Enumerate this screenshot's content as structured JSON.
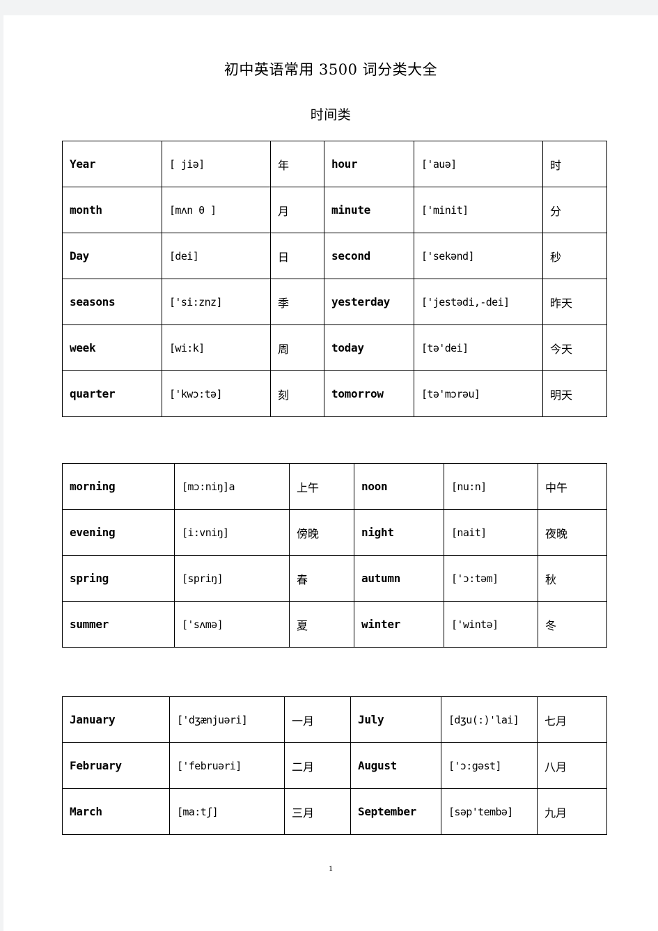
{
  "document": {
    "title": "初中英语常用 3500 词分类大全",
    "subtitle": "时间类",
    "page_number": "1"
  },
  "tables": [
    {
      "name": "time-units",
      "rows": [
        {
          "word_l": "Year",
          "phon_l": "[ jiə]",
          "cn_l": "年",
          "word_r": "hour",
          "phon_r": "['auə]",
          "cn_r": "时"
        },
        {
          "word_l": "month",
          "phon_l": "[mʌn θ ]",
          "cn_l": "月",
          "word_r": "minute",
          "phon_r": "['minit]",
          "cn_r": "分"
        },
        {
          "word_l": "Day",
          "phon_l": "[dei]",
          "cn_l": "日",
          "word_r": "second",
          "phon_r": "['sekənd]",
          "cn_r": "秒"
        },
        {
          "word_l": "seasons",
          "phon_l": "['si:znz]",
          "cn_l": "季",
          "word_r": "yesterday",
          "phon_r": "['jestədi,-dei]",
          "cn_r": "昨天"
        },
        {
          "word_l": "week",
          "phon_l": "[wi:k]",
          "cn_l": "周",
          "word_r": "today",
          "phon_r": "[tə'dei]",
          "cn_r": "今天"
        },
        {
          "word_l": "quarter",
          "phon_l": "['kwɔ:tə]",
          "cn_l": "刻",
          "word_r": "tomorrow",
          "phon_r": "[tə'mɔrəu]",
          "cn_r": "明天"
        }
      ]
    },
    {
      "name": "dayparts-seasons",
      "rows": [
        {
          "word_l": "morning",
          "phon_l": "[mɔ:niŋ]a",
          "cn_l": "上午",
          "word_r": "noon",
          "phon_r": "[nu:n]",
          "cn_r": "中午"
        },
        {
          "word_l": "evening",
          "phon_l": "[i:vniŋ]",
          "cn_l": "傍晚",
          "word_r": "night",
          "phon_r": "[nait]",
          "cn_r": "夜晚"
        },
        {
          "word_l": "spring",
          "phon_l": "[spriŋ]",
          "cn_l": "春",
          "word_r": "autumn",
          "phon_r": "['ɔ:təm]",
          "cn_r": "秋"
        },
        {
          "word_l": "summer",
          "phon_l": "['sʌmə]",
          "cn_l": "夏",
          "word_r": "winter",
          "phon_r": "['wintə]",
          "cn_r": "冬"
        }
      ]
    },
    {
      "name": "months",
      "rows": [
        {
          "word_l": "January",
          "phon_l": "['dʒænjuəri]",
          "cn_l": "一月",
          "word_r": "July",
          "phon_r": "[dʒu(:)'lai]",
          "cn_r": "七月"
        },
        {
          "word_l": "February",
          "phon_l": "['februəri]",
          "cn_l": "二月",
          "word_r": "August",
          "phon_r": "['ɔ:gəst]",
          "cn_r": "八月"
        },
        {
          "word_l": "March",
          "phon_l": "[ma:tʃ]",
          "cn_l": "三月",
          "word_r": "September",
          "phon_r": "[səp'tembə]",
          "cn_r": "九月"
        }
      ]
    }
  ]
}
